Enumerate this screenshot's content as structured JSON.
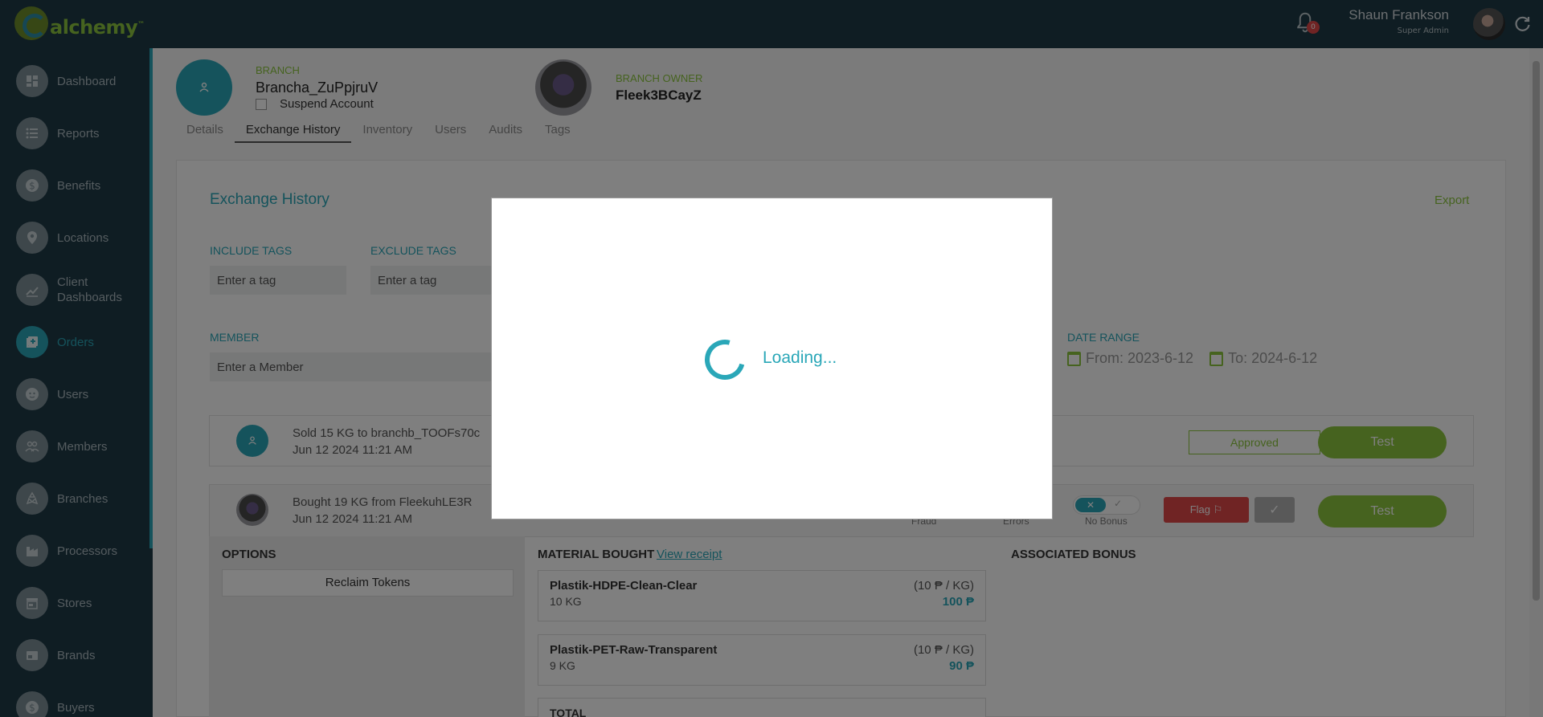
{
  "app": {
    "logo_text": "alchemy",
    "logo_tm": "™"
  },
  "header": {
    "notifications_count": "0",
    "user_name": "Shaun Frankson",
    "user_role": "Super Admin"
  },
  "sidebar": {
    "items": [
      {
        "label": "Dashboard",
        "icon": "dashboard-icon"
      },
      {
        "label": "Reports",
        "icon": "list-icon"
      },
      {
        "label": "Benefits",
        "icon": "dollar-icon"
      },
      {
        "label": "Locations",
        "icon": "pin-icon"
      },
      {
        "label": "Client Dashboards",
        "icon": "chart-icon"
      },
      {
        "label": "Orders",
        "icon": "add-box-icon",
        "active": true
      },
      {
        "label": "Users",
        "icon": "face-icon"
      },
      {
        "label": "Members",
        "icon": "people-icon"
      },
      {
        "label": "Branches",
        "icon": "recycle-icon"
      },
      {
        "label": "Processors",
        "icon": "factory-icon"
      },
      {
        "label": "Stores",
        "icon": "store-icon"
      },
      {
        "label": "Brands",
        "icon": "card-icon"
      },
      {
        "label": "Buyers",
        "icon": "dollar-icon"
      }
    ]
  },
  "branch": {
    "label": "BRANCH",
    "name": "Brancha_ZuPpjruV",
    "suspend_label": "Suspend Account",
    "owner_label": "BRANCH OWNER",
    "owner_name": "Fleek3BCayZ"
  },
  "tabs": [
    "Details",
    "Exchange History",
    "Inventory",
    "Users",
    "Audits",
    "Tags"
  ],
  "exchange": {
    "title": "Exchange History",
    "export_label": "Export",
    "include_tags_label": "INCLUDE TAGS",
    "include_tags_placeholder": "Enter a tag",
    "exclude_tags_label": "EXCLUDE TAGS",
    "exclude_tags_placeholder": "Enter a tag",
    "member_label": "MEMBER",
    "member_placeholder": "Enter a Member",
    "date_range_label": "DATE RANGE",
    "date_from": "From: 2023-6-12",
    "date_to": "To: 2024-6-12"
  },
  "rows": [
    {
      "title": "Sold 15 KG to branchb_TOOFs70c",
      "date": "Jun 12 2024 11:21 AM",
      "status": "Approved",
      "action": "Test"
    },
    {
      "title": "Bought 19 KG from FleekuhLE3R",
      "date": "Jun 12 2024 11:21 AM",
      "fraud_label": "Fraud",
      "errors_label": "Errors",
      "bonus_label": "No Bonus",
      "flag_label": "Flag",
      "action": "Test"
    }
  ],
  "details": {
    "options_title": "OPTIONS",
    "reclaim_label": "Reclaim Tokens",
    "material_title": "MATERIAL BOUGHT",
    "view_receipt": "View receipt",
    "associated_bonus": "ASSOCIATED BONUS",
    "materials": [
      {
        "name": "Plastik-HDPE-Clean-Clear",
        "qty": "10 KG",
        "rate": "(10 ₱ / KG)",
        "amount": "100 ₱"
      },
      {
        "name": "Plastik-PET-Raw-Transparent",
        "qty": "9 KG",
        "rate": "(10 ₱ / KG)",
        "amount": "90 ₱"
      }
    ],
    "total_label": "TOTAL"
  },
  "modal": {
    "loading_text": "Loading..."
  },
  "colors": {
    "teal": "#2aa7b8",
    "green": "#8cc63f",
    "navy": "#1e3a47",
    "red": "#e04848"
  }
}
